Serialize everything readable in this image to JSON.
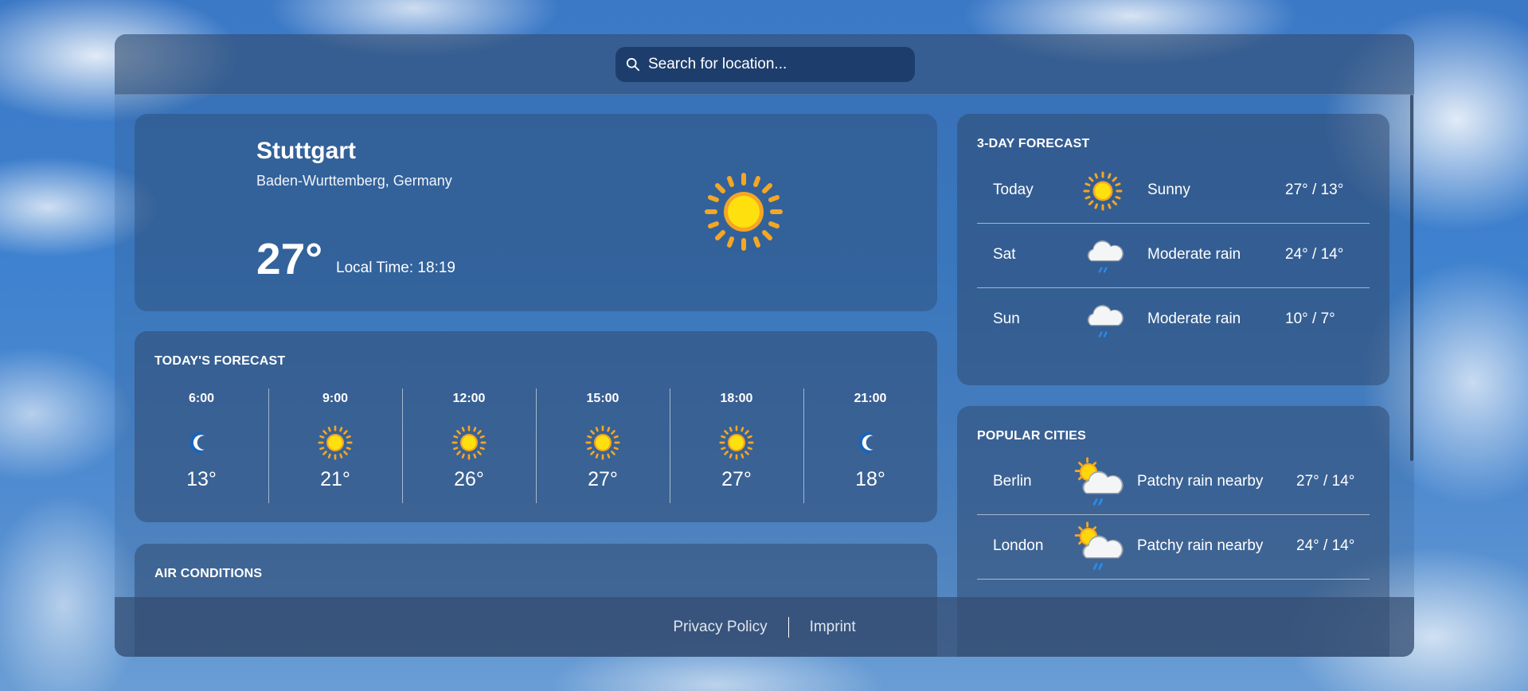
{
  "search": {
    "placeholder": "Search for location..."
  },
  "current": {
    "city": "Stuttgart",
    "region": "Baden-Wurttemberg, Germany",
    "temperature": "27°",
    "local_time": "Local Time: 18:19",
    "icon": "sun-icon"
  },
  "today_forecast": {
    "title": "TODAY'S FORECAST",
    "hours": [
      {
        "time": "6:00",
        "icon": "moon-icon",
        "temp": "13°"
      },
      {
        "time": "9:00",
        "icon": "sun-icon",
        "temp": "21°"
      },
      {
        "time": "12:00",
        "icon": "sun-icon",
        "temp": "26°"
      },
      {
        "time": "15:00",
        "icon": "sun-icon",
        "temp": "27°"
      },
      {
        "time": "18:00",
        "icon": "sun-icon",
        "temp": "27°"
      },
      {
        "time": "21:00",
        "icon": "moon-icon",
        "temp": "18°"
      }
    ]
  },
  "air_conditions": {
    "title": "AIR CONDITIONS"
  },
  "three_day": {
    "title": "3-DAY FORECAST",
    "days": [
      {
        "day": "Today",
        "icon": "sun-icon",
        "condition": "Sunny",
        "range": "27° / 13°"
      },
      {
        "day": "Sat",
        "icon": "rain-cloud-icon",
        "condition": "Moderate rain",
        "range": "24° / 14°"
      },
      {
        "day": "Sun",
        "icon": "rain-cloud-icon",
        "condition": "Moderate rain",
        "range": "10° / 7°"
      }
    ]
  },
  "popular_cities": {
    "title": "POPULAR CITIES",
    "cities": [
      {
        "city": "Berlin",
        "icon": "sun-rain-cloud-icon",
        "condition": "Patchy rain nearby",
        "range": "27° / 14°"
      },
      {
        "city": "London",
        "icon": "sun-rain-cloud-icon",
        "condition": "Patchy rain nearby",
        "range": "24° / 14°"
      }
    ]
  },
  "footer": {
    "privacy": "Privacy Policy",
    "imprint": "Imprint"
  },
  "colors": {
    "sun": "#ffd60a",
    "sun_ray": "#f5a623",
    "moon": "#1565c0",
    "rain": "#2a8be8",
    "cloud": "#f2f2f4"
  }
}
